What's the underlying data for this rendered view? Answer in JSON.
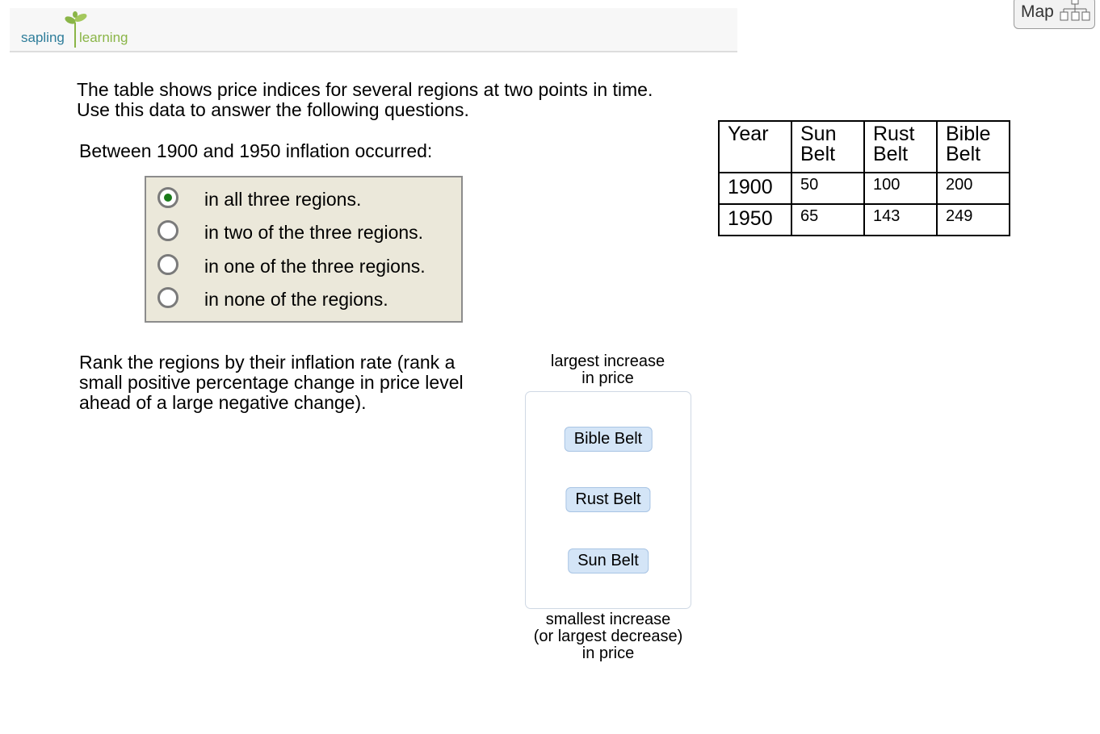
{
  "header": {
    "logo_word1": "sapling",
    "logo_word2": "learning",
    "map_label": "Map"
  },
  "intro": {
    "line1": "The table shows price indices for several regions at two points in time.",
    "line2": "Use this data to answer the following questions."
  },
  "question1": {
    "prompt": "Between 1900 and 1950 inflation occurred:",
    "options": [
      {
        "label": "in all three regions.",
        "selected": true
      },
      {
        "label": "in two of the three regions.",
        "selected": false
      },
      {
        "label": "in one of the three regions.",
        "selected": false
      },
      {
        "label": "in none of the regions.",
        "selected": false
      }
    ]
  },
  "question2": {
    "line1": "Rank the regions by their inflation rate (rank a",
    "line2": "small positive percentage change in price level",
    "line3": "ahead of a large negative change).",
    "top_label_1": "largest increase",
    "top_label_2": "in price",
    "items": [
      "Bible Belt",
      "Rust Belt",
      "Sun Belt"
    ],
    "bottom_label_1": "smallest increase",
    "bottom_label_2": "(or largest decrease)",
    "bottom_label_3": "in price"
  },
  "table": {
    "headers": [
      {
        "l1": "Year",
        "l2": ""
      },
      {
        "l1": "Sun",
        "l2": "Belt"
      },
      {
        "l1": "Rust",
        "l2": "Belt"
      },
      {
        "l1": "Bible",
        "l2": "Belt"
      }
    ],
    "rows": [
      [
        "1900",
        "50",
        "100",
        "200"
      ],
      [
        "1950",
        "65",
        "143",
        "249"
      ]
    ]
  },
  "colors": {
    "logo_blue": "#2e7d9a",
    "logo_green": "#8ab547",
    "options_bg": "#ebe8da",
    "radio_selected": "#1a7a1a",
    "rank_item_bg": "#d4e5f7"
  }
}
